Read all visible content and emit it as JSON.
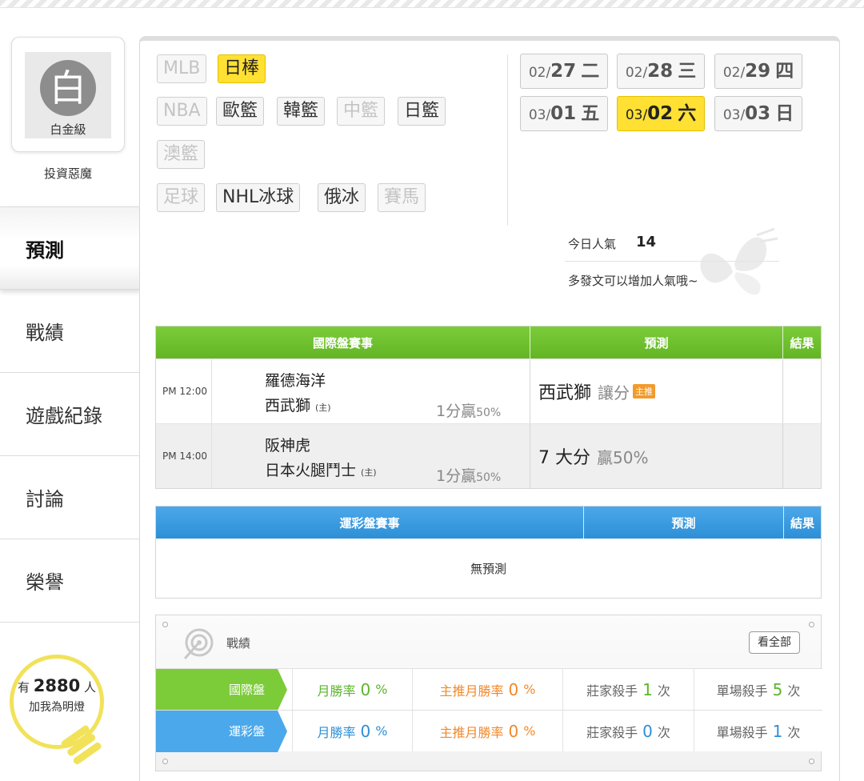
{
  "sidebar": {
    "level": "白金級",
    "avatar_char": "白",
    "username": "投資惡魔",
    "nav": [
      {
        "label": "預測"
      },
      {
        "label": "戰績"
      },
      {
        "label": "遊戲紀錄"
      },
      {
        "label": "討論"
      },
      {
        "label": "榮譽"
      }
    ],
    "lamp": {
      "prefix": "有",
      "count": "2880",
      "suffix": "人",
      "cta": "加我為明燈"
    }
  },
  "sports": {
    "row1": [
      {
        "label": "MLB",
        "state": "disabled"
      },
      {
        "label": "日棒",
        "state": "active"
      }
    ],
    "row2": [
      {
        "label": "NBA",
        "state": "disabled"
      },
      {
        "label": "歐籃",
        "state": "normal"
      },
      {
        "label": "韓籃",
        "state": "normal"
      },
      {
        "label": "中籃",
        "state": "disabled"
      },
      {
        "label": "日籃",
        "state": "normal"
      }
    ],
    "row3": [
      {
        "label": "澳籃",
        "state": "disabled"
      }
    ],
    "row4": [
      {
        "label": "足球",
        "state": "disabled"
      },
      {
        "label": "NHL冰球",
        "state": "normal"
      },
      {
        "label": "俄冰",
        "state": "normal"
      },
      {
        "label": "賽馬",
        "state": "disabled"
      }
    ]
  },
  "dates": [
    {
      "month": "02/",
      "day": "27",
      "weekday": "二",
      "active": false
    },
    {
      "month": "02/",
      "day": "28",
      "weekday": "三",
      "active": false
    },
    {
      "month": "02/",
      "day": "29",
      "weekday": "四",
      "active": false
    },
    {
      "month": "03/",
      "day": "01",
      "weekday": "五",
      "active": false
    },
    {
      "month": "03/",
      "day": "02",
      "weekday": "六",
      "active": true
    },
    {
      "month": "03/",
      "day": "03",
      "weekday": "日",
      "active": false
    }
  ],
  "popularity": {
    "label": "今日人氣",
    "value": "14",
    "hint": "多發文可以增加人氣哦~"
  },
  "intl_table": {
    "headers": {
      "event": "國際盤賽事",
      "prediction": "預測",
      "result": "結果"
    },
    "rows": [
      {
        "time": "PM 12:00",
        "away": "羅德海洋",
        "home": "西武獅",
        "home_mark": "(主)",
        "spread": "1分贏",
        "spread_pct": "50%",
        "pick": "西武獅",
        "pick_type": "讓分",
        "badge": "主推"
      },
      {
        "time": "PM 14:00",
        "away": "阪神虎",
        "home": "日本火腿鬥士",
        "home_mark": "(主)",
        "spread": "1分贏",
        "spread_pct": "50%",
        "pick": "7 大分",
        "pick_type": "贏50%",
        "badge": ""
      }
    ]
  },
  "lottery_table": {
    "headers": {
      "event": "運彩盤賽事",
      "prediction": "預測",
      "result": "結果"
    },
    "empty": "無預測"
  },
  "record": {
    "title": "戰績",
    "see_all": "看全部",
    "rows": [
      {
        "label": "國際盤",
        "color": "#7ccc3a",
        "monthly_label": "月勝率",
        "monthly": "0",
        "top_label": "主推月勝率",
        "top": "0",
        "pct": "%",
        "bank_label": "莊家殺手",
        "bank": "1",
        "single_label": "單場殺手",
        "single": "5",
        "unit": "次"
      },
      {
        "label": "運彩盤",
        "color": "#4ba8ea",
        "monthly_label": "月勝率",
        "monthly": "0",
        "top_label": "主推月勝率",
        "top": "0",
        "pct": "%",
        "bank_label": "莊家殺手",
        "bank": "0",
        "single_label": "單場殺手",
        "single": "1",
        "unit": "次"
      }
    ]
  }
}
